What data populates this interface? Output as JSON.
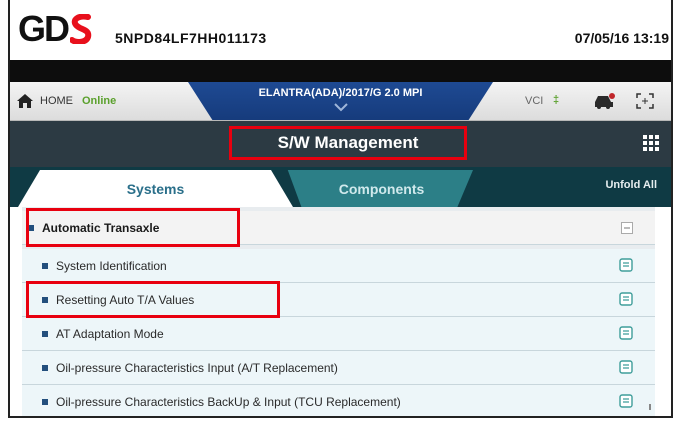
{
  "titlebar": {
    "vin": "5NPD84LF7HH011173",
    "datetime": "07/05/16 13:19"
  },
  "navbar": {
    "home_label": "HOME",
    "status_label": "Online",
    "vehicle_label": "ELANTRA(ADA)/2017/G 2.0 MPI",
    "vci_label": "VCI",
    "vci_status": "‡"
  },
  "header": {
    "page_title": "S/W Management"
  },
  "tabs": {
    "systems_label": "Systems",
    "components_label": "Components",
    "unfold_all_label": "Unfold All"
  },
  "list": {
    "group_label": "Automatic Transaxle",
    "items": [
      {
        "label": "System Identification"
      },
      {
        "label": "Resetting Auto T/A Values"
      },
      {
        "label": "AT Adaptation Mode"
      },
      {
        "label": "Oil-pressure Characteristics Input (A/T Replacement)"
      },
      {
        "label": "Oil-pressure Characteristics BackUp & Input (TCU Replacement)"
      }
    ]
  },
  "colors": {
    "highlight": "#e8000f",
    "header_bg": "#2c3a43",
    "vehicle_bg": "#1e4a93",
    "online": "#5aa02c"
  }
}
